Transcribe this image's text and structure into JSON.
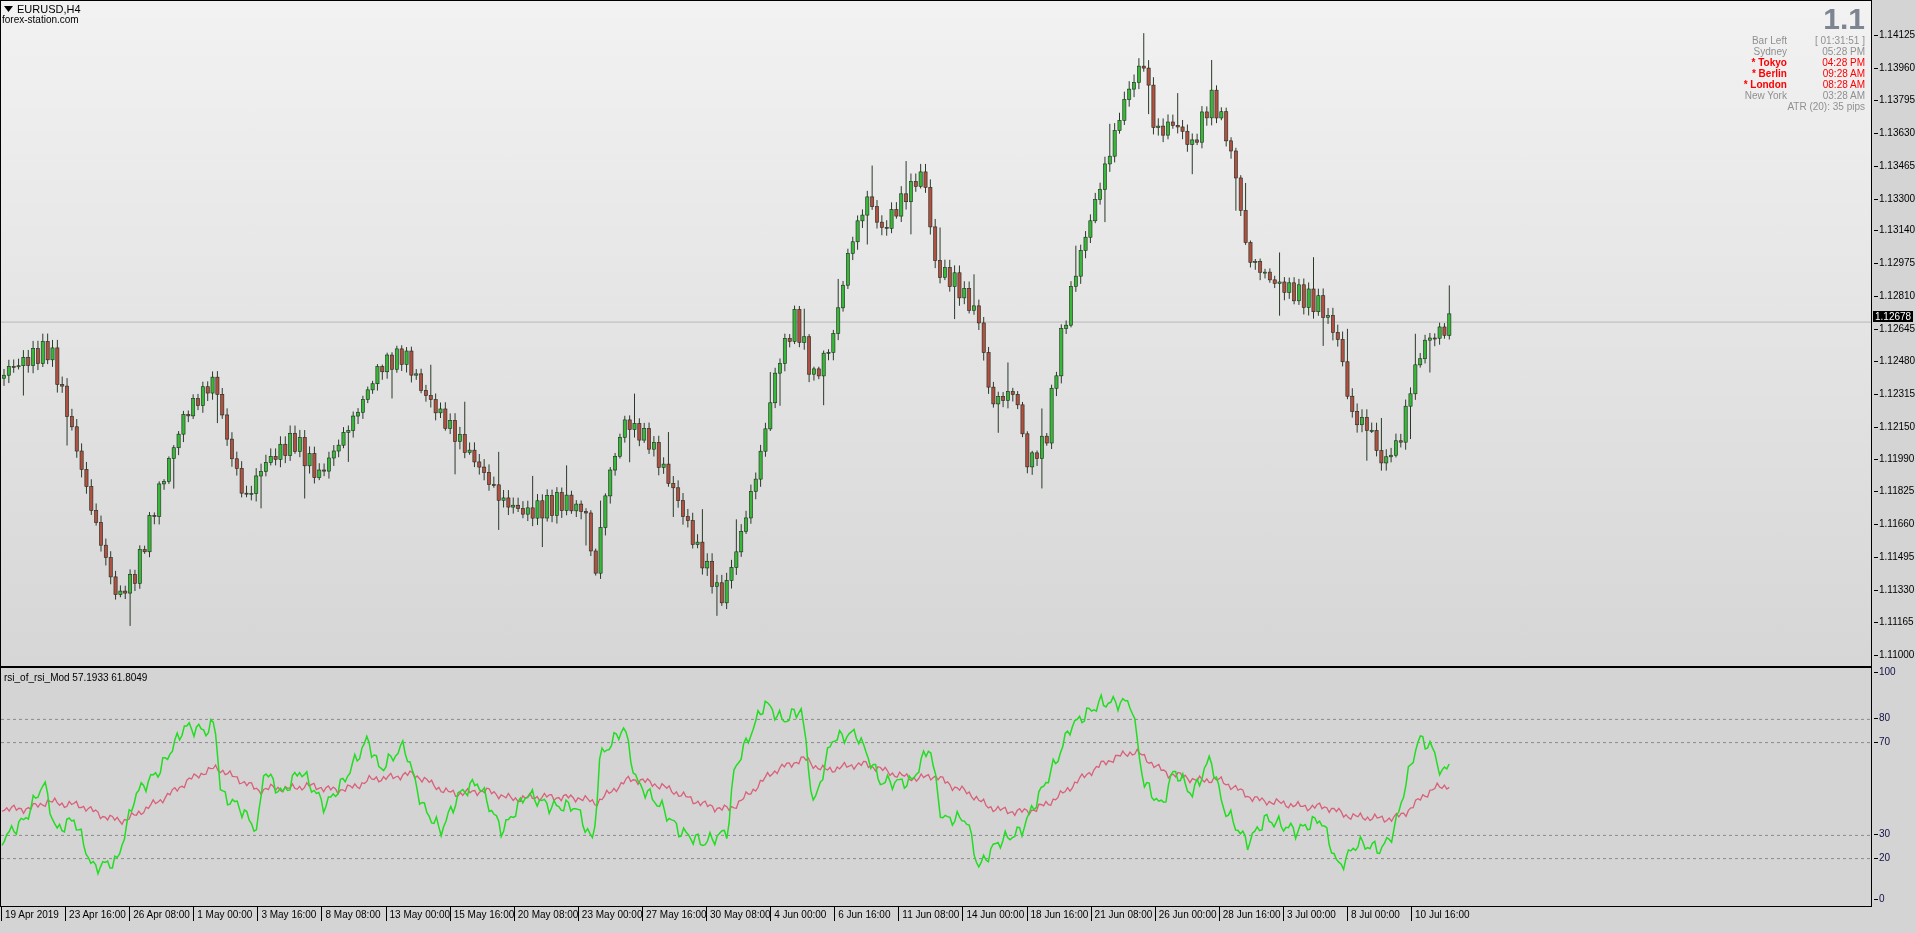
{
  "chart": {
    "symbol": "EURUSD,H4",
    "source_label": "forex-station.com",
    "current_price": "1.12678"
  },
  "info_panel": {
    "big_value": "1.1",
    "rows": [
      {
        "label": "Bar Left",
        "value": "[ 01:31:51 ]",
        "color": "#909090"
      },
      {
        "label": "Sydney",
        "value": "05:28 PM",
        "color": "#909090"
      },
      {
        "label": "* Tokyo",
        "value": "04:28 PM",
        "color": "#ff0000"
      },
      {
        "label": "* Berlin",
        "value": "09:28 AM",
        "color": "#ff0000"
      },
      {
        "label": "* London",
        "value": "08:28 AM",
        "color": "#ff0000"
      },
      {
        "label": "New York",
        "value": "03:28 AM",
        "color": "#909090"
      }
    ],
    "footer": "ATR (20): 35 pips"
  },
  "price_axis": {
    "ticks": [
      "1.14125",
      "1.13960",
      "1.13795",
      "1.13630",
      "1.13465",
      "1.13300",
      "1.13140",
      "1.12975",
      "1.12810",
      "1.12645",
      "1.12480",
      "1.12315",
      "1.12150",
      "1.11990",
      "1.11825",
      "1.11660",
      "1.11495",
      "1.11330",
      "1.11165",
      "1.11000"
    ]
  },
  "indicator": {
    "title": "rsi_of_rsi_Mod 57.1933 61.8049",
    "axis_labels": [
      "100",
      "80",
      "70",
      "30",
      "20",
      "0"
    ]
  },
  "time_axis": {
    "labels": [
      "19 Apr 2019",
      "23 Apr 16:00",
      "26 Apr 08:00",
      "1 May 00:00",
      "3 May 16:00",
      "8 May 08:00",
      "13 May 00:00",
      "15 May 16:00",
      "20 May 08:00",
      "23 May 00:00",
      "27 May 16:00",
      "30 May 08:00",
      "4 Jun 00:00",
      "6 Jun 16:00",
      "11 Jun 08:00",
      "14 Jun 00:00",
      "18 Jun 16:00",
      "21 Jun 08:00",
      "26 Jun 00:00",
      "28 Jun 16:00",
      "3 Jul 00:00",
      "8 Jul 00:00",
      "10 Jul 16:00"
    ]
  }
}
